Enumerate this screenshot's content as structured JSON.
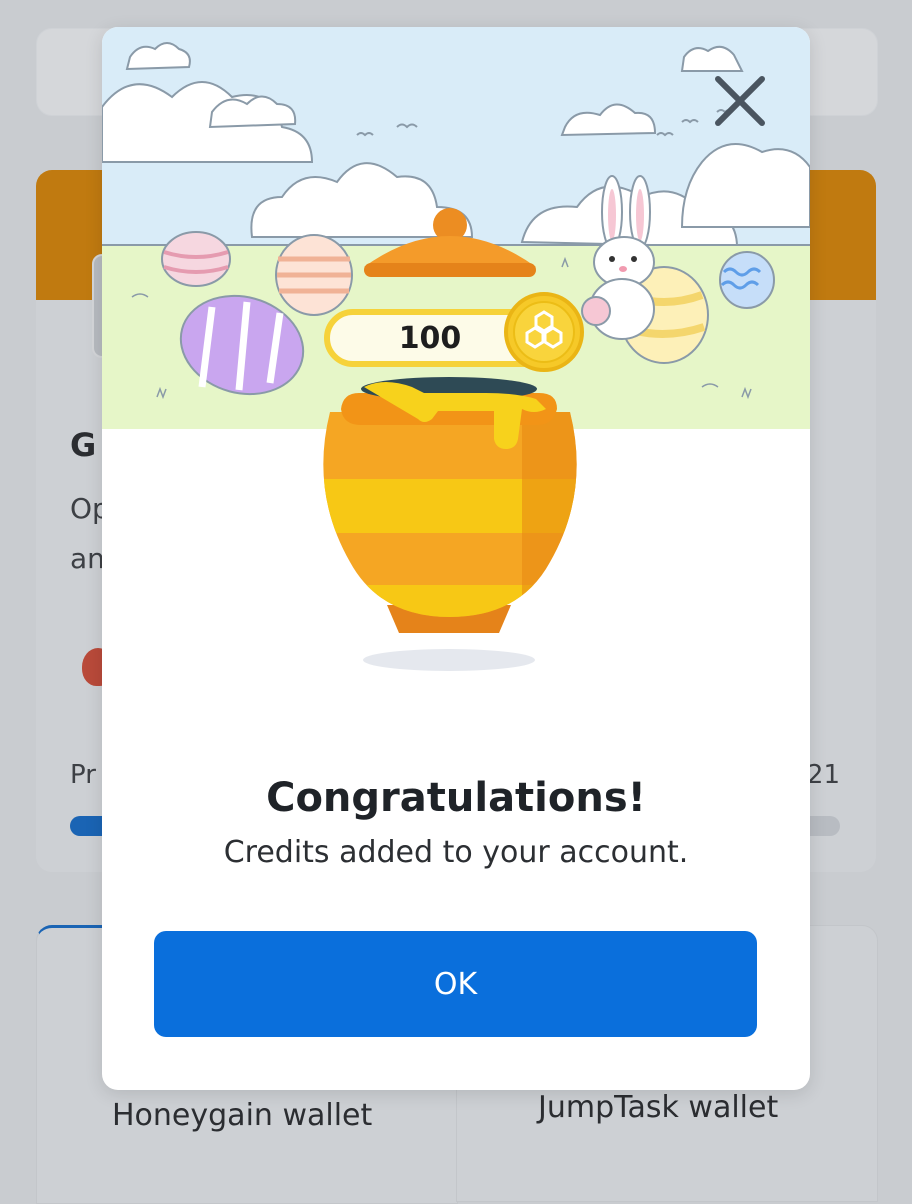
{
  "background": {
    "heading_fragment": "G",
    "desc_line1_fragment": "Op",
    "desc_line2_fragment": "an",
    "progress_label_fragment": "Pr",
    "progress_value_fragment": "21",
    "progress_fraction": 0.4,
    "wallets": [
      {
        "label": "Honeygain wallet"
      },
      {
        "label": "JumpTask wallet"
      }
    ]
  },
  "modal": {
    "reward_amount": "100",
    "title": "Congratulations!",
    "subtitle": "Credits added to your account.",
    "ok_label": "OK",
    "colors": {
      "primary_button": "#0a6fdc",
      "coin_gold": "#f6c928",
      "sky": "#d9ecf8",
      "grass": "#e6f6c8"
    }
  }
}
